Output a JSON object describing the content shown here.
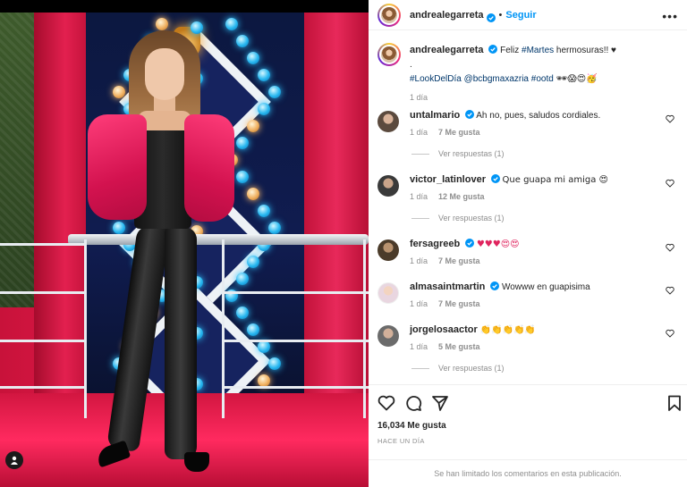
{
  "post": {
    "author": "andrealegarreta",
    "follow_label": "Seguir",
    "separator": "•",
    "caption_greeting": "Feliz",
    "caption_hashtag_martes": "#Martes",
    "caption_rest": "hermosuras!! ♥",
    "caption_dot": ".",
    "caption_tags": [
      "#LookDelDía",
      "@bcbgmaxazria",
      "#ootd"
    ],
    "caption_emoji": "🕶😱😍🥳",
    "caption_time": "1 día",
    "likes": "16,034 Me gusta",
    "posted": "Hace un día",
    "comments_limited": "Se han limitado los comentarios en esta publicación."
  },
  "comments": [
    {
      "user": "untalmario",
      "text": "Ah no, pues, saludos cordiales.",
      "time": "1 día",
      "likes": "7 Me gusta",
      "replies": "Ver respuestas (1)",
      "avatar_color": "#5b4a3e"
    },
    {
      "user": "victor_latinlover",
      "text": "Que guapa mi amiga 😍",
      "time": "1 día",
      "likes": "12 Me gusta",
      "replies": "Ver respuestas (1)",
      "avatar_color": "#3a3a3a"
    },
    {
      "user": "fersagreeb",
      "text": "♥♥♥😍😍",
      "time": "1 día",
      "likes": "7 Me gusta",
      "replies": "",
      "avatar_color": "#4b3b2a"
    },
    {
      "user": "almasaintmartin",
      "text": "Wowww en guapisima",
      "time": "1 día",
      "likes": "7 Me gusta",
      "replies": "",
      "avatar_color": "#e9d6e0"
    },
    {
      "user": "jorgelosaactor",
      "text": "👏👏👏👏👏",
      "time": "1 día",
      "likes": "5 Me gusta",
      "replies": "Ver respuestas (1)",
      "avatar_color": "#6b6b6b"
    }
  ],
  "colors": {
    "link": "#0095f6",
    "hashtag": "#00376b",
    "muted": "#8e8e8e",
    "heart": "#e0245e"
  },
  "icons": [
    "verified-icon",
    "more-icon",
    "heart-icon",
    "comment-icon",
    "share-icon",
    "bookmark-icon",
    "user-tag-icon"
  ]
}
